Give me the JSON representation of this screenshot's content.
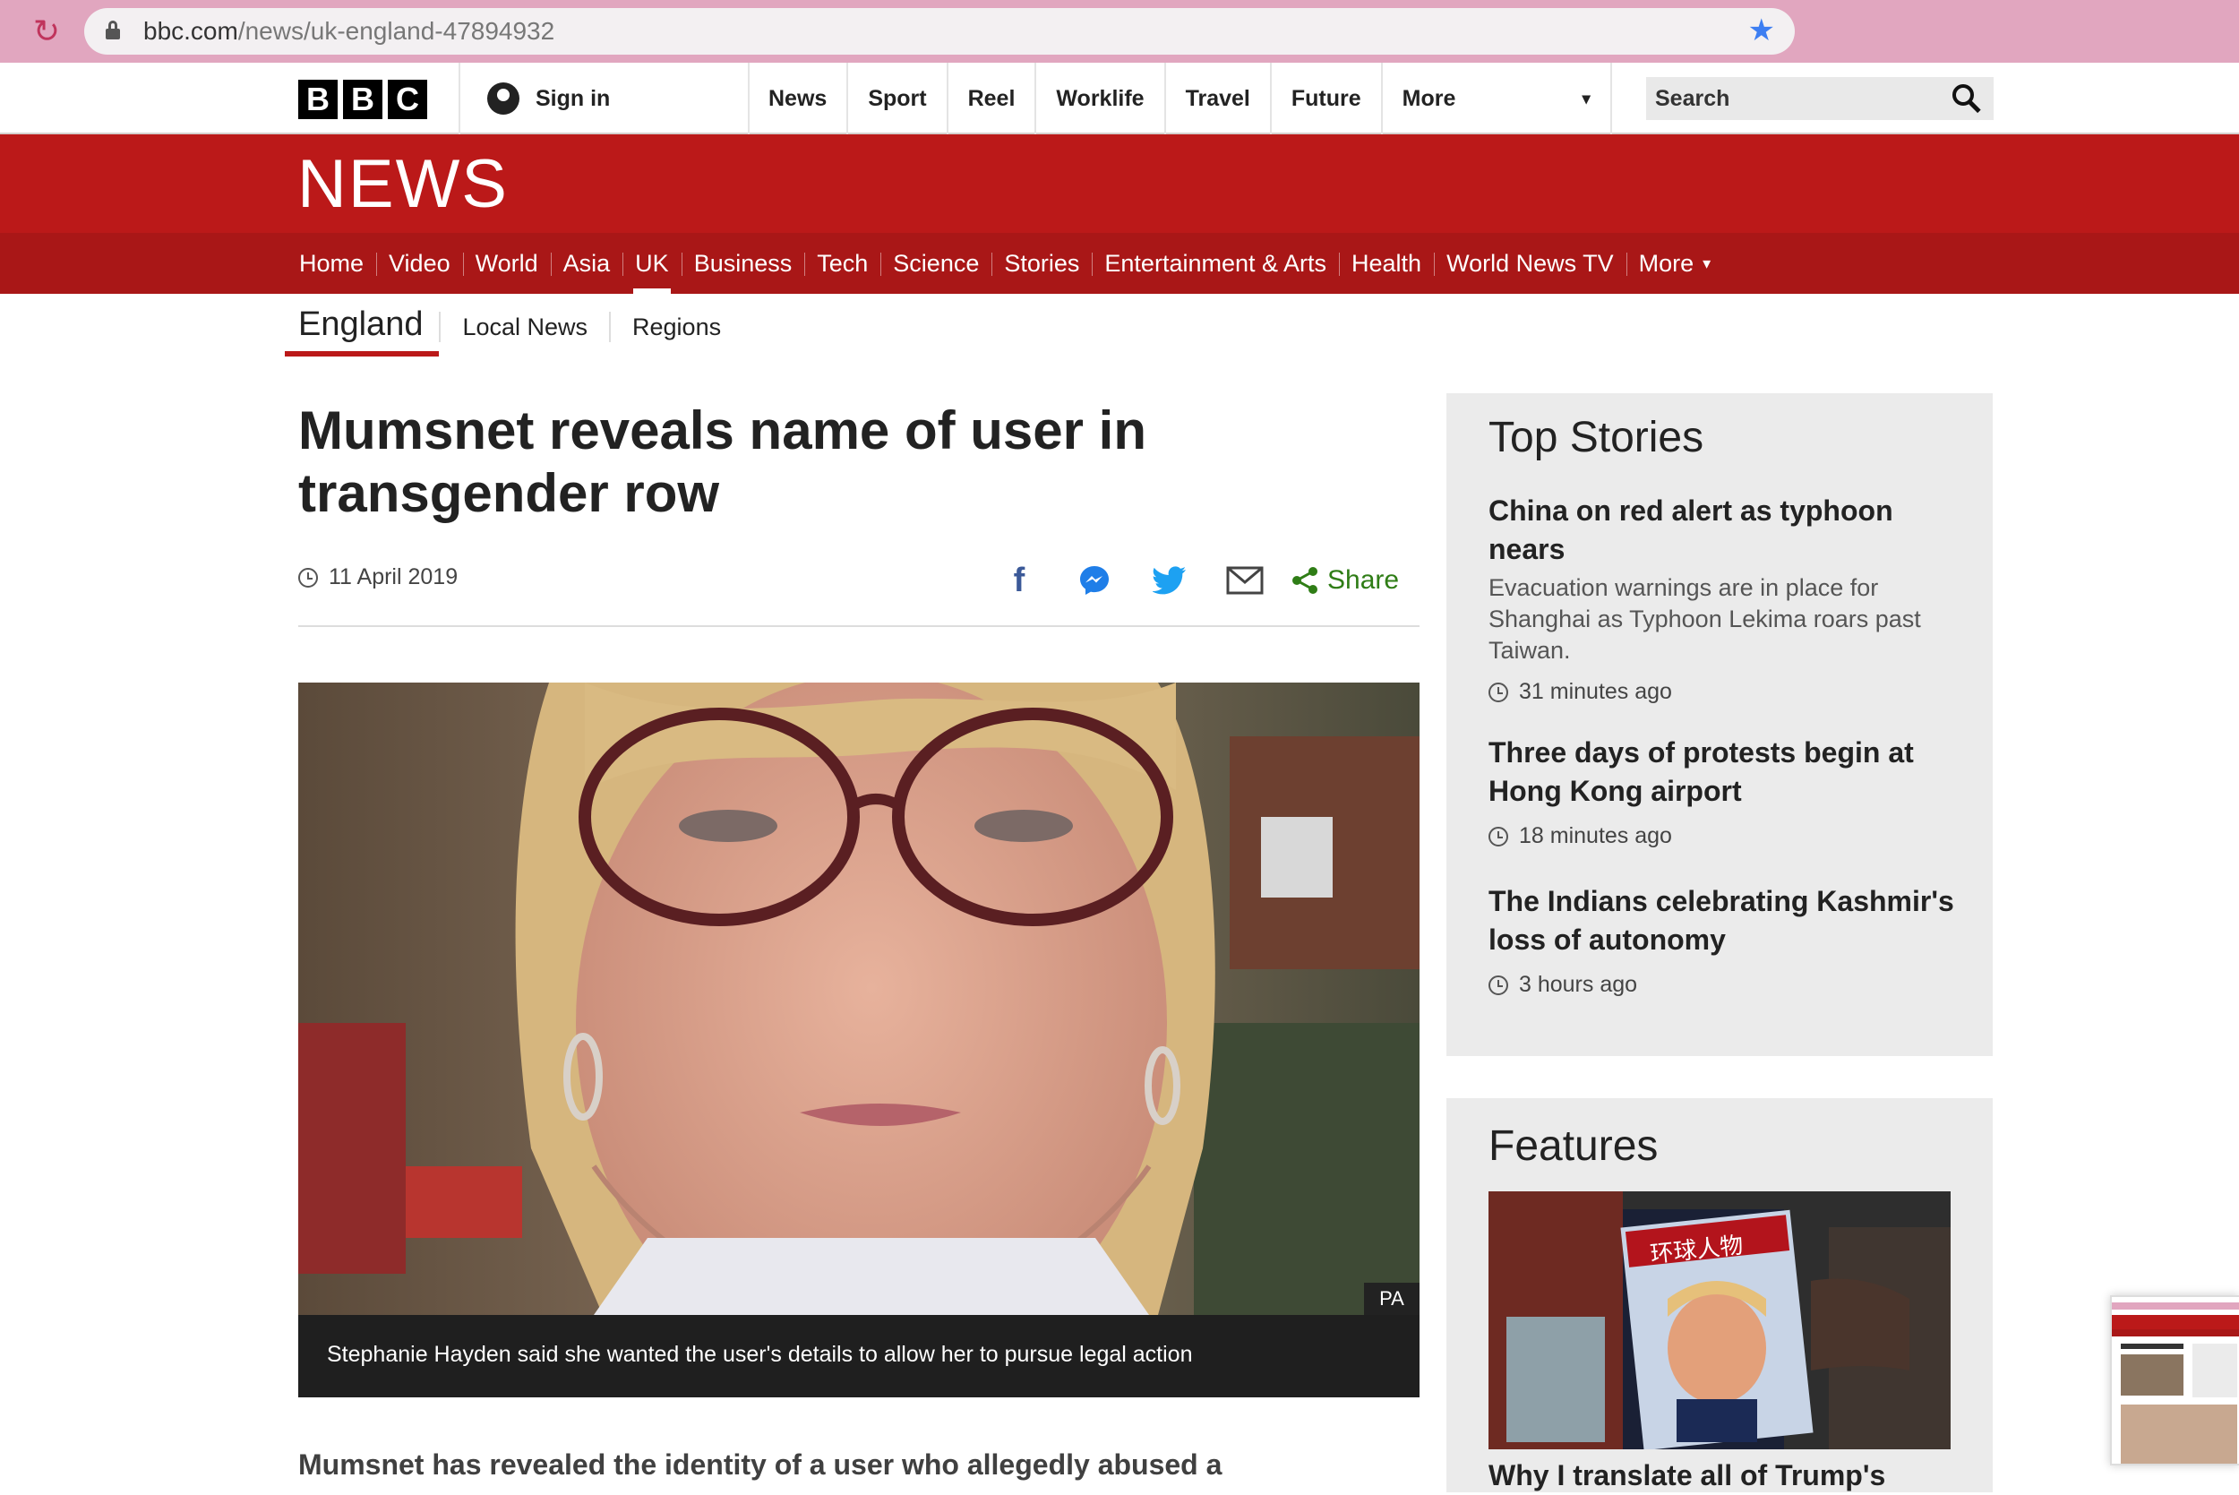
{
  "browser": {
    "url_host": "bbc.com",
    "url_path": "/news/uk-england-47894932"
  },
  "topbar": {
    "logo_letters": [
      "B",
      "B",
      "C"
    ],
    "signin_label": "Sign in",
    "nav": [
      "News",
      "Sport",
      "Reel",
      "Worklife",
      "Travel",
      "Future"
    ],
    "more_label": "More",
    "search_placeholder": "Search"
  },
  "masthead": {
    "title": "NEWS"
  },
  "section_nav": {
    "items": [
      "Home",
      "Video",
      "World",
      "Asia",
      "UK",
      "Business",
      "Tech",
      "Science",
      "Stories",
      "Entertainment & Arts",
      "Health",
      "World News TV",
      "More"
    ],
    "active": "UK"
  },
  "subnav": {
    "current": "England",
    "items": [
      "Local News",
      "Regions"
    ]
  },
  "article": {
    "headline": "Mumsnet reveals name of user in transgender row",
    "date": "11 April 2019",
    "share_label": "Share",
    "photo_credit": "PA",
    "caption": "Stephanie Hayden said she wanted the user's details to allow her to pursue legal action",
    "lead": "Mumsnet has revealed the identity of a user who allegedly abused a"
  },
  "sidebar": {
    "top_stories_title": "Top Stories",
    "stories": [
      {
        "title": "China on red alert as typhoon nears",
        "summary": "Evacuation warnings are in place for Shanghai as Typhoon Lekima roars past Taiwan.",
        "time": "31 minutes ago"
      },
      {
        "title": "Three days of protests begin at Hong Kong airport",
        "summary": "",
        "time": "18 minutes ago"
      },
      {
        "title": "The Indians celebrating Kashmir's loss of autonomy",
        "summary": "",
        "time": "3 hours ago"
      }
    ],
    "features_title": "Features",
    "feature_title": "Why I translate all of Trump's",
    "feature_magazine_text": "环球人物"
  },
  "colors": {
    "brand_red": "#bb1919",
    "nav_red": "#a91717",
    "share_green": "#2f7d16",
    "chrome_pink": "#e1a6bf"
  }
}
